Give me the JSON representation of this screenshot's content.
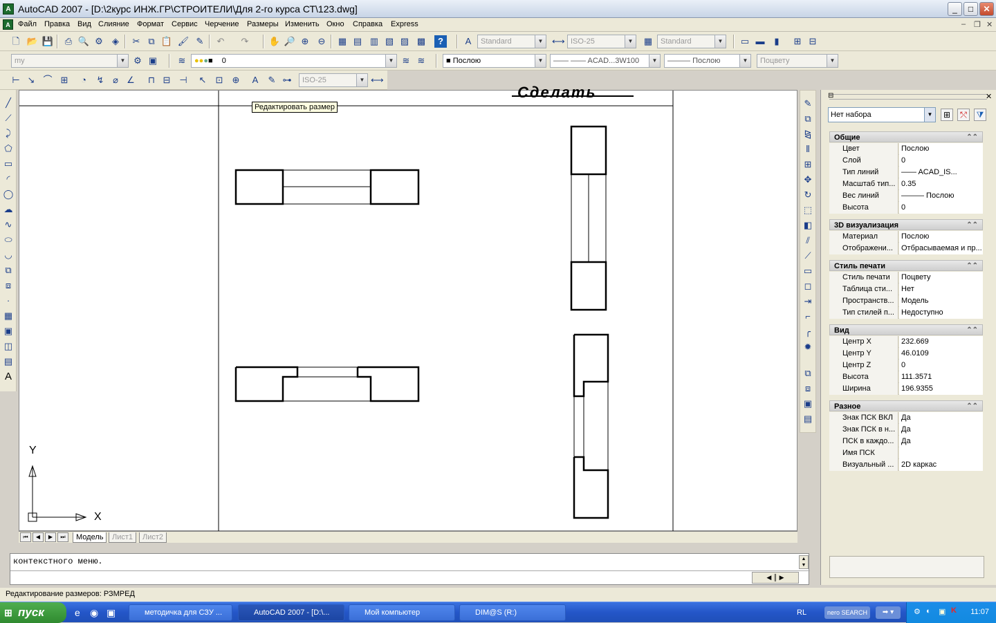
{
  "window": {
    "title": "AutoCAD 2007 - [D:\\2курс ИНЖ.ГР\\СТРОИТЕЛИ\\Для 2-го курса СТ\\123.dwg]",
    "min": "_",
    "max": "□",
    "close": "✕"
  },
  "menu": [
    "Файл",
    "Правка",
    "Вид",
    "Слияние",
    "Формат",
    "Сервис",
    "Черчение",
    "Размеры",
    "Изменить",
    "Окно",
    "Справка",
    "Express"
  ],
  "toolbar1": {
    "text_style": "Standard",
    "dim_style": "ISO-25",
    "table_style": "Standard"
  },
  "toolbar2": {
    "workspace": "my",
    "layer": "0",
    "color": "Послою",
    "linetype": "ACAD...3W100",
    "lineweight": "Послою",
    "plotstyle": "Поцвету"
  },
  "toolbar3": {
    "dim_style": "ISO-25"
  },
  "tooltip": "Редактировать размер",
  "drawing_title": "Сделать",
  "ucs": {
    "x": "X",
    "y": "Y"
  },
  "layout_tabs": [
    {
      "label": "Модель",
      "active": true
    },
    {
      "label": "Лист1",
      "active": false
    },
    {
      "label": "Лист2",
      "active": false
    }
  ],
  "command_line": "контекстного меню.",
  "status": "Редактирование размеров:  РЗМРЕД",
  "properties": {
    "selection": "Нет набора",
    "sections": [
      {
        "title": "Общие",
        "rows": [
          [
            "Цвет",
            "Послою"
          ],
          [
            "Слой",
            "0"
          ],
          [
            "Тип линий",
            "—— ACAD_IS..."
          ],
          [
            "Масштаб тип...",
            "0.35"
          ],
          [
            "Вес линий",
            "——— Послою"
          ],
          [
            "Высота",
            "0"
          ]
        ]
      },
      {
        "title": "3D визуализация",
        "rows": [
          [
            "Материал",
            "Послою"
          ],
          [
            "Отображени...",
            "Отбрасываемая и пр..."
          ]
        ]
      },
      {
        "title": "Стиль печати",
        "rows": [
          [
            "Стиль печати",
            "Поцвету"
          ],
          [
            "Таблица сти...",
            "Нет"
          ],
          [
            "Пространств...",
            "Модель"
          ],
          [
            "Тип стилей п...",
            "Недоступно"
          ]
        ]
      },
      {
        "title": "Вид",
        "rows": [
          [
            "Центр X",
            "232.669"
          ],
          [
            "Центр Y",
            "46.0109"
          ],
          [
            "Центр Z",
            "0"
          ],
          [
            "Высота",
            "111.3571"
          ],
          [
            "Ширина",
            "196.9355"
          ]
        ]
      },
      {
        "title": "Разное",
        "rows": [
          [
            "Знак ПСК ВКЛ",
            "Да"
          ],
          [
            "Знак ПСК в н...",
            "Да"
          ],
          [
            "ПСК в каждо...",
            "Да"
          ],
          [
            "Имя ПСК",
            ""
          ],
          [
            "Визуальный ...",
            "2D каркас"
          ]
        ]
      }
    ]
  },
  "taskbar": {
    "start": "пуск",
    "items": [
      {
        "label": "методичка для СЗУ ...",
        "active": false
      },
      {
        "label": "AutoCAD 2007 - [D:\\...",
        "active": true
      },
      {
        "label": "Мой компьютер",
        "active": false
      },
      {
        "label": "DIM@S (R:)",
        "active": false
      }
    ],
    "lang": "RL",
    "search": "nero SEARCH",
    "clock": "11:07"
  }
}
